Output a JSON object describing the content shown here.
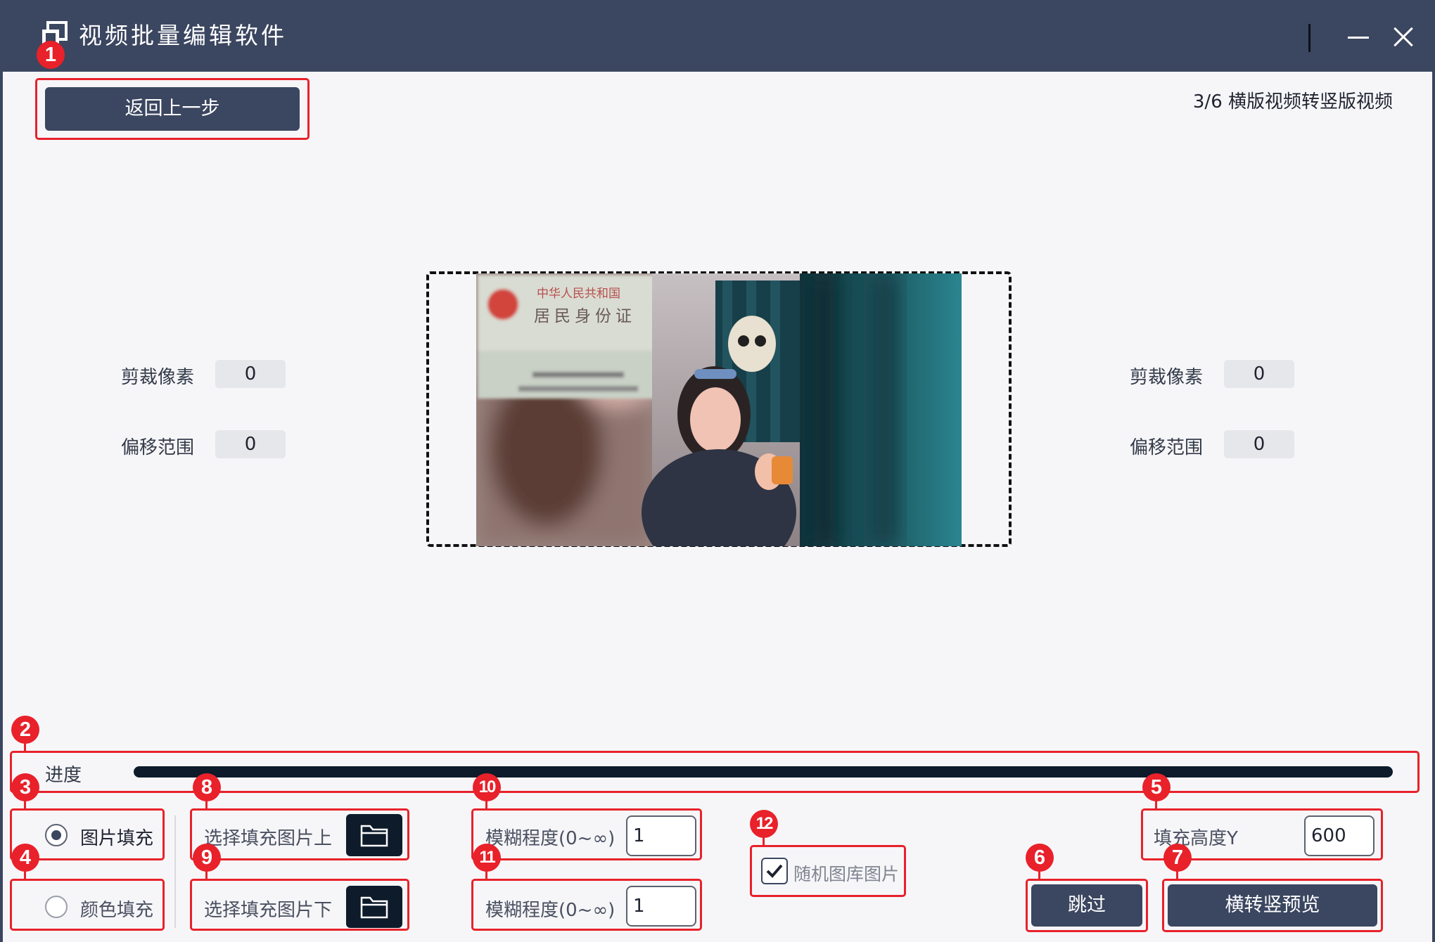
{
  "window": {
    "title": "视频批量编辑软件",
    "logo_icon": "app-window-icon",
    "minimize_icon": "minimize-icon",
    "close_icon": "close-icon"
  },
  "header": {
    "back_label": "返回上一步",
    "step_text": "3/6 横版视频转竖版视频"
  },
  "left_panel": {
    "crop_label": "剪裁像素",
    "crop_value": "0",
    "offset_label": "偏移范围",
    "offset_value": "0"
  },
  "right_panel": {
    "crop_label": "剪裁像素",
    "crop_value": "0",
    "offset_label": "偏移范围",
    "offset_value": "0"
  },
  "preview": {
    "id_card_line1": "中华人民共和国",
    "id_card_line2": "居民身份证"
  },
  "progress": {
    "label": "进度",
    "value": 1.0
  },
  "fill_mode": {
    "options": [
      "图片填充",
      "颜色填充"
    ],
    "selected": "图片填充"
  },
  "fill_images": {
    "top_label": "选择填充图片上",
    "bottom_label": "选择填充图片下",
    "folder_icon": "folder-icon"
  },
  "blur": {
    "label_top": "模糊程度(0~∞)",
    "value_top": "1",
    "label_bottom": "模糊程度(0~∞)",
    "value_bottom": "1"
  },
  "random_gallery": {
    "label": "随机图库图片",
    "checked": true
  },
  "fill_height": {
    "label": "填充高度Y",
    "value": "600"
  },
  "actions": {
    "skip_label": "跳过",
    "preview_label": "横转竖预览"
  },
  "annotations": [
    "1",
    "2",
    "3",
    "4",
    "5",
    "6",
    "7",
    "8",
    "9",
    "10",
    "11",
    "12"
  ],
  "colors": {
    "titlebar": "#3b4660",
    "annotation": "#e8212a",
    "progress": "#0d1b2a",
    "background": "#f6f6f9"
  }
}
